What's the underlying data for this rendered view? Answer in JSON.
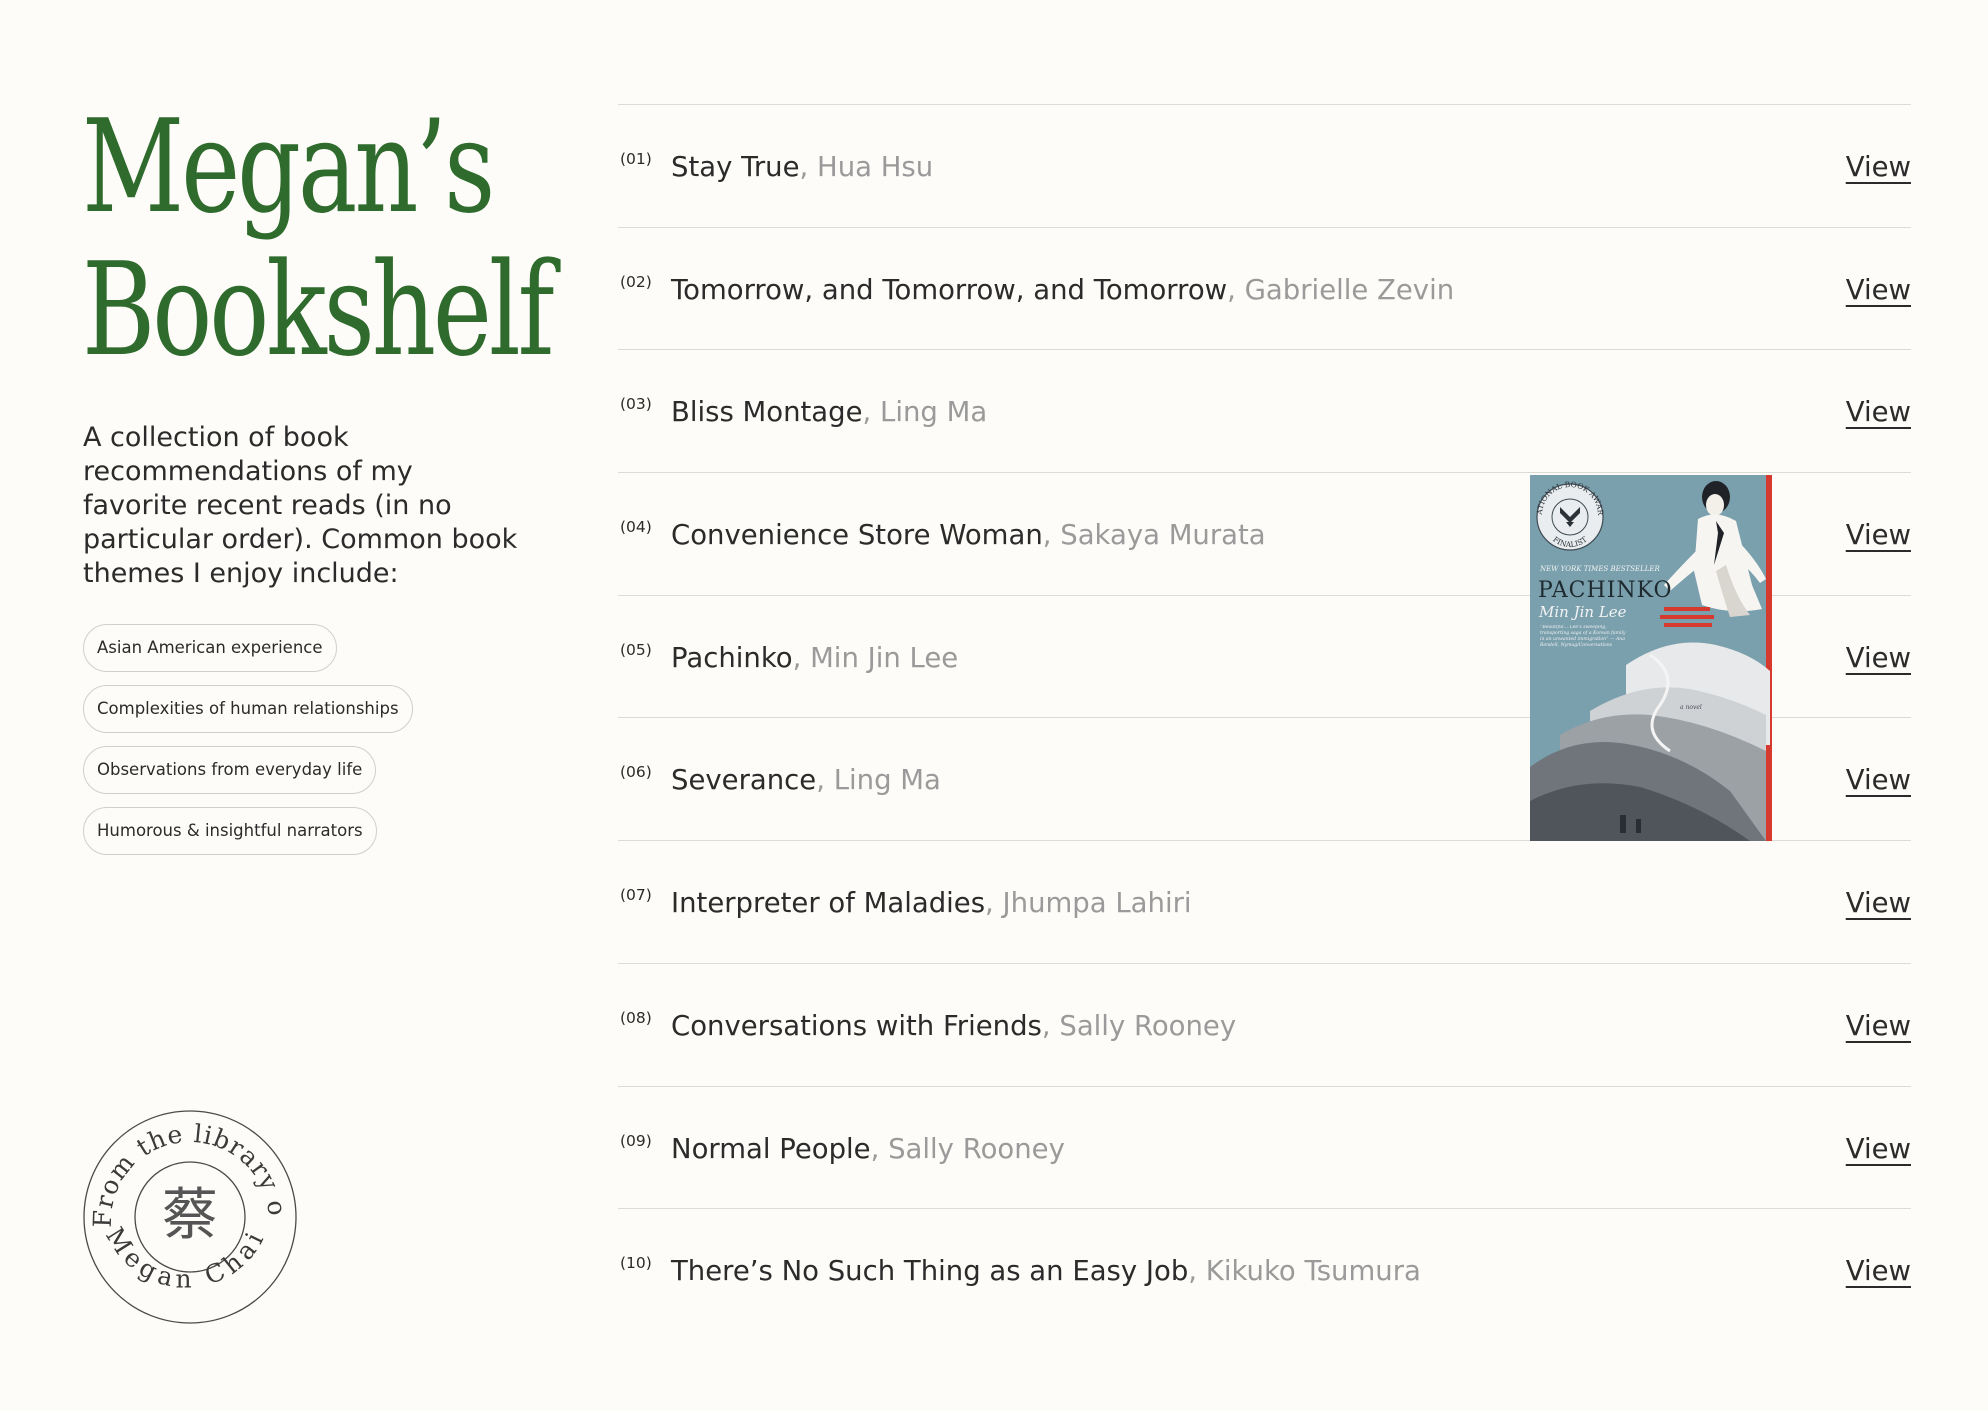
{
  "header": {
    "title_line1": "Megan’s",
    "title_line2": "Bookshelf"
  },
  "intro": "A collection of book recommendations of my favorite recent reads (in no particular order). Common book themes I enjoy include:",
  "themes": [
    "Asian American experience",
    "Complexities of human relationships",
    "Observations from everyday life",
    "Humorous & insightful narrators"
  ],
  "stamp": {
    "top_text": "From the library of",
    "bottom_text": "Megan Chai",
    "center_char": "蔡"
  },
  "books": [
    {
      "num": "(01)",
      "title": "Stay True",
      "author": "Hua Hsu",
      "link": "View"
    },
    {
      "num": "(02)",
      "title": "Tomorrow, and Tomorrow, and Tomorrow",
      "author": "Gabrielle Zevin",
      "link": "View"
    },
    {
      "num": "(03)",
      "title": "Bliss Montage",
      "author": "Ling Ma",
      "link": "View"
    },
    {
      "num": "(04)",
      "title": "Convenience Store Woman",
      "author": "Sakaya Murata",
      "link": "View"
    },
    {
      "num": "(05)",
      "title": "Pachinko",
      "author": "Min Jin Lee",
      "link": "View"
    },
    {
      "num": "(06)",
      "title": "Severance",
      "author": "Ling Ma",
      "link": "View"
    },
    {
      "num": "(07)",
      "title": "Interpreter of Maladies",
      "author": "Jhumpa Lahiri",
      "link": "View"
    },
    {
      "num": "(08)",
      "title": "Conversations with Friends",
      "author": "Sally Rooney",
      "link": "View"
    },
    {
      "num": "(09)",
      "title": "Normal People",
      "author": "Sally Rooney",
      "link": "View"
    },
    {
      "num": "(10)",
      "title": "There’s No Such Thing as an Easy Job",
      "author": "Kikuko Tsumura",
      "link": "View"
    }
  ],
  "hover_cover": {
    "badge_top": "NATIONAL BOOK AWARD",
    "badge_bottom": "FINALIST",
    "bestseller": "NEW YORK TIMES BESTSELLER",
    "title": "PACHINKO",
    "author": "Min Jin Lee",
    "blurb": "“Beautiful… Lee's sweeping, transporting saga of a Korean family in an unwanted immigration” — Ana Bendell, Nymag/Conversations",
    "tag": "a novel"
  },
  "colors": {
    "accent_green": "#2e6b2c",
    "background": "#fdfcf8",
    "text": "#2b2b2b",
    "muted": "#9a9a9a",
    "cover_blue": "#7aa0ae",
    "cover_red": "#d63a2f"
  }
}
